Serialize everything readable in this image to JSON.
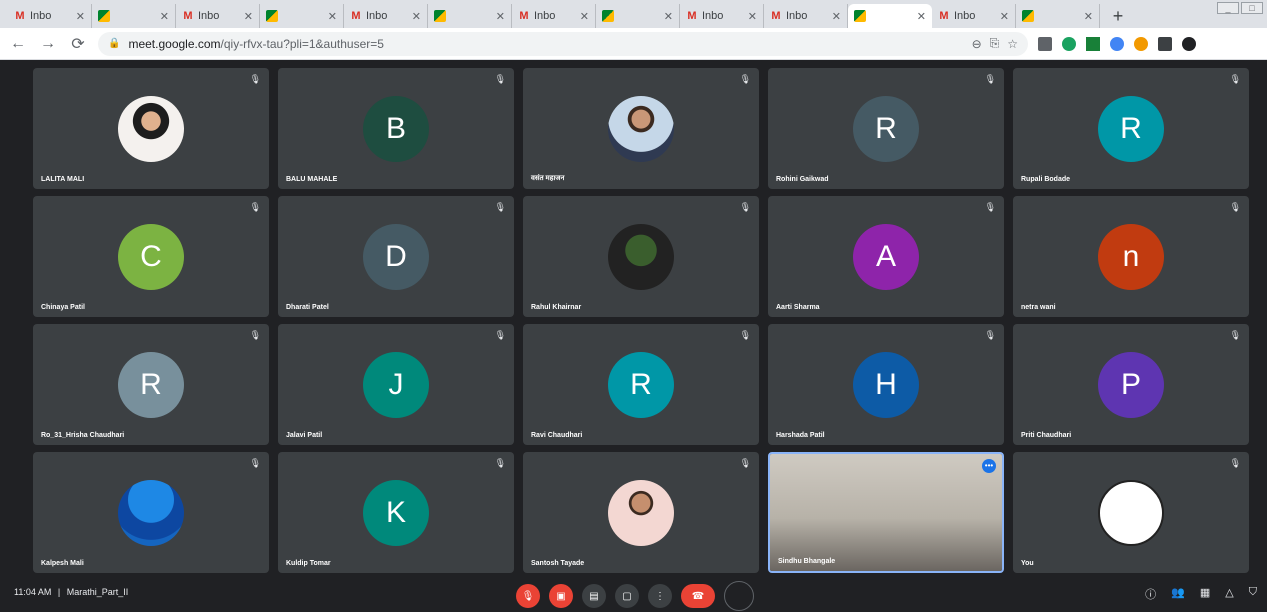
{
  "browser": {
    "tabs": [
      {
        "title": "Inbo",
        "type": "gmail",
        "active": false
      },
      {
        "title": "",
        "type": "meet",
        "active": false
      },
      {
        "title": "Inbo",
        "type": "gmail",
        "active": false
      },
      {
        "title": "",
        "type": "meet",
        "active": false
      },
      {
        "title": "Inbo",
        "type": "gmail",
        "active": false
      },
      {
        "title": "",
        "type": "meet",
        "active": false
      },
      {
        "title": "Inbo",
        "type": "gmail",
        "active": false
      },
      {
        "title": "",
        "type": "meet",
        "active": false
      },
      {
        "title": "Inbo",
        "type": "gmail",
        "active": false
      },
      {
        "title": "Inbo",
        "type": "gmail",
        "active": false
      },
      {
        "title": "",
        "type": "meet",
        "active": true
      },
      {
        "title": "Inbo",
        "type": "gmail",
        "active": false
      },
      {
        "title": "",
        "type": "meet",
        "active": false
      }
    ],
    "url_host": "meet.google.com",
    "url_path": "/qiy-rfvx-tau?pli=1&authuser=5"
  },
  "participants": [
    {
      "name": "LALITA MALI",
      "initial": "",
      "color": "",
      "photo": "ph1"
    },
    {
      "name": "BALU MAHALE",
      "initial": "B",
      "color": "#1e4d40",
      "photo": ""
    },
    {
      "name": "वसंत महाजन",
      "initial": "",
      "color": "",
      "photo": "ph2"
    },
    {
      "name": "Rohini Gaikwad",
      "initial": "R",
      "color": "#455a64",
      "photo": ""
    },
    {
      "name": "Rupali Bodade",
      "initial": "R",
      "color": "#0097a7",
      "photo": ""
    },
    {
      "name": "Chinaya Patil",
      "initial": "C",
      "color": "#7cb342",
      "photo": ""
    },
    {
      "name": "Dharati Patel",
      "initial": "D",
      "color": "#455a64",
      "photo": ""
    },
    {
      "name": "Rahul Khairnar",
      "initial": "",
      "color": "",
      "photo": "ph3"
    },
    {
      "name": "Aarti Sharma",
      "initial": "A",
      "color": "#8e24aa",
      "photo": ""
    },
    {
      "name": "netra wani",
      "initial": "n",
      "color": "#c13b10",
      "photo": ""
    },
    {
      "name": "Ro_31_Hrisha Chaudhari",
      "initial": "R",
      "color": "#78909c",
      "photo": ""
    },
    {
      "name": "Jalavi Patil",
      "initial": "J",
      "color": "#00897b",
      "photo": ""
    },
    {
      "name": "Ravi Chaudhari",
      "initial": "R",
      "color": "#0097a7",
      "photo": ""
    },
    {
      "name": "Harshada Patil",
      "initial": "H",
      "color": "#0d5ba6",
      "photo": ""
    },
    {
      "name": "Priti Chaudhari",
      "initial": "P",
      "color": "#5e35b1",
      "photo": ""
    },
    {
      "name": "Kalpesh Mali",
      "initial": "",
      "color": "",
      "photo": "ph4"
    },
    {
      "name": "Kuldip Tomar",
      "initial": "K",
      "color": "#00897b",
      "photo": ""
    },
    {
      "name": "Santosh Tayade",
      "initial": "",
      "color": "",
      "photo": "ph5"
    },
    {
      "name": "Sindhu Bhangale",
      "initial": "",
      "color": "",
      "photo": "video",
      "speaking": true
    },
    {
      "name": "You",
      "initial": "",
      "color": "",
      "photo": "ph6"
    }
  ],
  "bottom": {
    "time": "11:04 AM",
    "separator": "|",
    "meeting_name": "Marathi_Part_II"
  }
}
